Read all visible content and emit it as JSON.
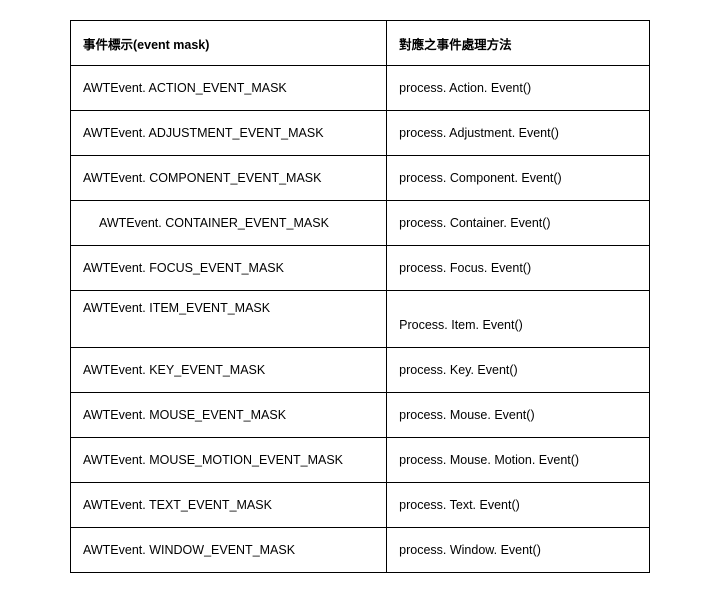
{
  "headers": {
    "mask": "事件標示(event mask)",
    "method": "對應之事件處理方法"
  },
  "rows": [
    {
      "mask": "AWTEvent. ACTION_EVENT_MASK",
      "method": "process. Action. Event()"
    },
    {
      "mask": "AWTEvent. ADJUSTMENT_EVENT_MASK",
      "method": "process. Adjustment. Event()"
    },
    {
      "mask": "AWTEvent. COMPONENT_EVENT_MASK",
      "method": "process. Component. Event()"
    },
    {
      "mask": "AWTEvent. CONTAINER_EVENT_MASK",
      "method": "process. Container. Event()",
      "indent": true
    },
    {
      "mask": "AWTEvent. FOCUS_EVENT_MASK",
      "method": "process. Focus. Event()"
    },
    {
      "mask": "AWTEvent. ITEM_EVENT_MASK",
      "method": "Process. Item. Event()",
      "itemRow": true
    },
    {
      "mask": "AWTEvent. KEY_EVENT_MASK",
      "method": "process. Key. Event()"
    },
    {
      "mask": "AWTEvent. MOUSE_EVENT_MASK",
      "method": "process. Mouse. Event()"
    },
    {
      "mask": "AWTEvent. MOUSE_MOTION_EVENT_MASK",
      "method": "process. Mouse. Motion. Event()"
    },
    {
      "mask": "AWTEvent. TEXT_EVENT_MASK",
      "method": "process. Text. Event()"
    },
    {
      "mask": "AWTEvent. WINDOW_EVENT_MASK",
      "method": "process. Window. Event()"
    }
  ]
}
